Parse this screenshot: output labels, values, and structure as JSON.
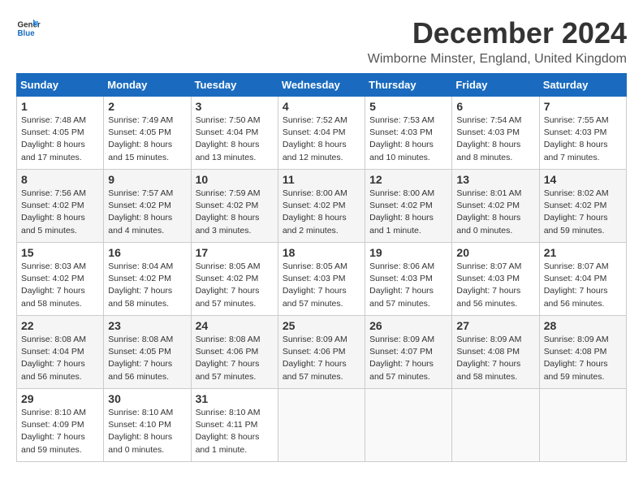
{
  "logo": {
    "line1": "General",
    "line2": "Blue"
  },
  "title": "December 2024",
  "subtitle": "Wimborne Minster, England, United Kingdom",
  "days_of_week": [
    "Sunday",
    "Monday",
    "Tuesday",
    "Wednesday",
    "Thursday",
    "Friday",
    "Saturday"
  ],
  "weeks": [
    [
      {
        "day": "1",
        "sunrise": "7:48 AM",
        "sunset": "4:05 PM",
        "daylight": "8 hours and 17 minutes."
      },
      {
        "day": "2",
        "sunrise": "7:49 AM",
        "sunset": "4:05 PM",
        "daylight": "8 hours and 15 minutes."
      },
      {
        "day": "3",
        "sunrise": "7:50 AM",
        "sunset": "4:04 PM",
        "daylight": "8 hours and 13 minutes."
      },
      {
        "day": "4",
        "sunrise": "7:52 AM",
        "sunset": "4:04 PM",
        "daylight": "8 hours and 12 minutes."
      },
      {
        "day": "5",
        "sunrise": "7:53 AM",
        "sunset": "4:03 PM",
        "daylight": "8 hours and 10 minutes."
      },
      {
        "day": "6",
        "sunrise": "7:54 AM",
        "sunset": "4:03 PM",
        "daylight": "8 hours and 8 minutes."
      },
      {
        "day": "7",
        "sunrise": "7:55 AM",
        "sunset": "4:03 PM",
        "daylight": "8 hours and 7 minutes."
      }
    ],
    [
      {
        "day": "8",
        "sunrise": "7:56 AM",
        "sunset": "4:02 PM",
        "daylight": "8 hours and 5 minutes."
      },
      {
        "day": "9",
        "sunrise": "7:57 AM",
        "sunset": "4:02 PM",
        "daylight": "8 hours and 4 minutes."
      },
      {
        "day": "10",
        "sunrise": "7:59 AM",
        "sunset": "4:02 PM",
        "daylight": "8 hours and 3 minutes."
      },
      {
        "day": "11",
        "sunrise": "8:00 AM",
        "sunset": "4:02 PM",
        "daylight": "8 hours and 2 minutes."
      },
      {
        "day": "12",
        "sunrise": "8:00 AM",
        "sunset": "4:02 PM",
        "daylight": "8 hours and 1 minute."
      },
      {
        "day": "13",
        "sunrise": "8:01 AM",
        "sunset": "4:02 PM",
        "daylight": "8 hours and 0 minutes."
      },
      {
        "day": "14",
        "sunrise": "8:02 AM",
        "sunset": "4:02 PM",
        "daylight": "7 hours and 59 minutes."
      }
    ],
    [
      {
        "day": "15",
        "sunrise": "8:03 AM",
        "sunset": "4:02 PM",
        "daylight": "7 hours and 58 minutes."
      },
      {
        "day": "16",
        "sunrise": "8:04 AM",
        "sunset": "4:02 PM",
        "daylight": "7 hours and 58 minutes."
      },
      {
        "day": "17",
        "sunrise": "8:05 AM",
        "sunset": "4:02 PM",
        "daylight": "7 hours and 57 minutes."
      },
      {
        "day": "18",
        "sunrise": "8:05 AM",
        "sunset": "4:03 PM",
        "daylight": "7 hours and 57 minutes."
      },
      {
        "day": "19",
        "sunrise": "8:06 AM",
        "sunset": "4:03 PM",
        "daylight": "7 hours and 57 minutes."
      },
      {
        "day": "20",
        "sunrise": "8:07 AM",
        "sunset": "4:03 PM",
        "daylight": "7 hours and 56 minutes."
      },
      {
        "day": "21",
        "sunrise": "8:07 AM",
        "sunset": "4:04 PM",
        "daylight": "7 hours and 56 minutes."
      }
    ],
    [
      {
        "day": "22",
        "sunrise": "8:08 AM",
        "sunset": "4:04 PM",
        "daylight": "7 hours and 56 minutes."
      },
      {
        "day": "23",
        "sunrise": "8:08 AM",
        "sunset": "4:05 PM",
        "daylight": "7 hours and 56 minutes."
      },
      {
        "day": "24",
        "sunrise": "8:08 AM",
        "sunset": "4:06 PM",
        "daylight": "7 hours and 57 minutes."
      },
      {
        "day": "25",
        "sunrise": "8:09 AM",
        "sunset": "4:06 PM",
        "daylight": "7 hours and 57 minutes."
      },
      {
        "day": "26",
        "sunrise": "8:09 AM",
        "sunset": "4:07 PM",
        "daylight": "7 hours and 57 minutes."
      },
      {
        "day": "27",
        "sunrise": "8:09 AM",
        "sunset": "4:08 PM",
        "daylight": "7 hours and 58 minutes."
      },
      {
        "day": "28",
        "sunrise": "8:09 AM",
        "sunset": "4:08 PM",
        "daylight": "7 hours and 59 minutes."
      }
    ],
    [
      {
        "day": "29",
        "sunrise": "8:10 AM",
        "sunset": "4:09 PM",
        "daylight": "7 hours and 59 minutes."
      },
      {
        "day": "30",
        "sunrise": "8:10 AM",
        "sunset": "4:10 PM",
        "daylight": "8 hours and 0 minutes."
      },
      {
        "day": "31",
        "sunrise": "8:10 AM",
        "sunset": "4:11 PM",
        "daylight": "8 hours and 1 minute."
      },
      null,
      null,
      null,
      null
    ]
  ]
}
